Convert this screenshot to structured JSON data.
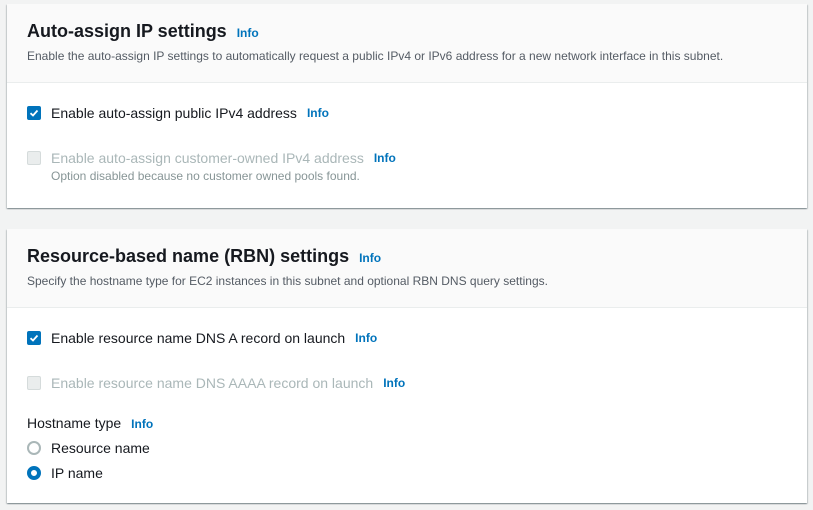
{
  "auto_assign": {
    "title": "Auto-assign IP settings",
    "info": "Info",
    "description": "Enable the auto-assign IP settings to automatically request a public IPv4 or IPv6 address for a new network interface in this subnet.",
    "ipv4": {
      "label": "Enable auto-assign public IPv4 address",
      "info": "Info",
      "checked": true
    },
    "customer_ipv4": {
      "label": "Enable auto-assign customer-owned IPv4 address",
      "info": "Info",
      "disabled": true,
      "hint": "Option disabled because no customer owned pools found."
    }
  },
  "rbn": {
    "title": "Resource-based name (RBN) settings",
    "info": "Info",
    "description": "Specify the hostname type for EC2 instances in this subnet and optional RBN DNS query settings.",
    "dns_a": {
      "label": "Enable resource name DNS A record on launch",
      "info": "Info",
      "checked": true
    },
    "dns_aaaa": {
      "label": "Enable resource name DNS AAAA record on launch",
      "info": "Info",
      "disabled": true
    },
    "hostname_type": {
      "label": "Hostname type",
      "info": "Info",
      "options": [
        {
          "label": "Resource name",
          "selected": false
        },
        {
          "label": "IP name",
          "selected": true
        }
      ]
    }
  },
  "colors": {
    "accent": "#0073bb",
    "disabled": "#aab7b8",
    "text": "#16191f"
  }
}
